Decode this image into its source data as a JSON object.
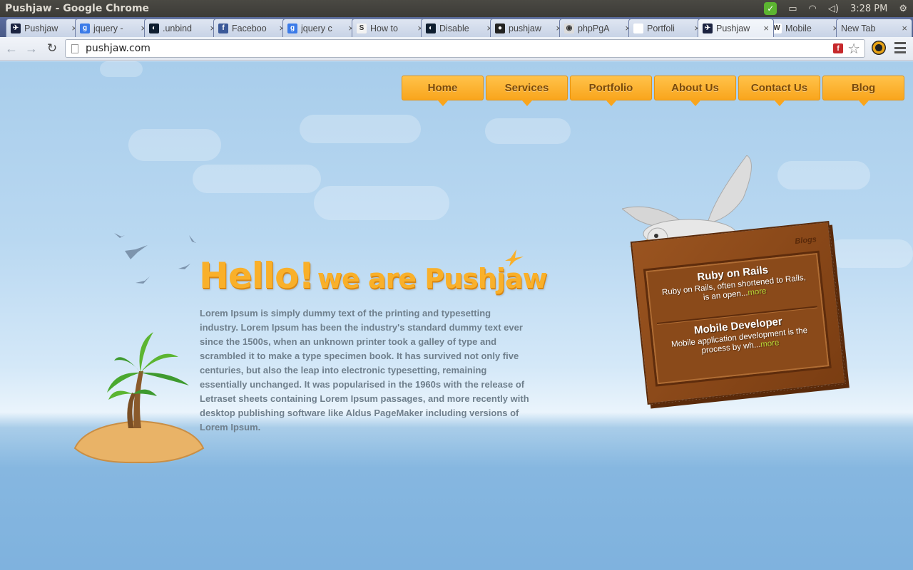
{
  "os": {
    "window_title": "Pushjaw - Google Chrome",
    "clock": "3:28 PM"
  },
  "tabs": [
    {
      "label": "Pushjaw",
      "icon": "pushjaw-icon",
      "color": "#1b2340",
      "glyph": "✈"
    },
    {
      "label": "jquery -",
      "icon": "google-icon",
      "color": "#3b7be8",
      "glyph": "g"
    },
    {
      "label": ".unbind",
      "icon": "jquery-icon",
      "color": "#0e1d2f",
      "glyph": "◐"
    },
    {
      "label": "Faceboo",
      "icon": "facebook-icon",
      "color": "#3b5998",
      "glyph": "f"
    },
    {
      "label": "jquery c",
      "icon": "google-icon",
      "color": "#3b7be8",
      "glyph": "g"
    },
    {
      "label": "How to",
      "icon": "stackoverflow-icon",
      "color": "#f2f2f2",
      "glyph": "S"
    },
    {
      "label": "Disable",
      "icon": "jquery-icon",
      "color": "#0e1d2f",
      "glyph": "◐"
    },
    {
      "label": "pushjaw",
      "icon": "github-icon",
      "color": "#222222",
      "glyph": "●"
    },
    {
      "label": "phpPgA",
      "icon": "postgres-icon",
      "color": "#dcdcdc",
      "glyph": "◉"
    },
    {
      "label": "Portfoli",
      "icon": "page-icon",
      "color": "#ffffff",
      "glyph": ""
    },
    {
      "label": "Pushjaw",
      "icon": "pushjaw-icon",
      "color": "#1b2340",
      "glyph": "✈"
    },
    {
      "label": "Mobile",
      "icon": "wikipedia-icon",
      "color": "#ffffff",
      "glyph": "W"
    },
    {
      "label": "New Tab",
      "icon": "",
      "color": "",
      "glyph": ""
    }
  ],
  "toolbar": {
    "url": "pushjaw.com"
  },
  "site": {
    "nav": [
      "Home",
      "Services",
      "Portfolio",
      "About Us",
      "Contact Us",
      "Blog"
    ],
    "hero_title_a": "Hello!",
    "hero_title_b": "we are Pushjaw",
    "hero_text": "Lorem Ipsum is simply dummy text of the printing and typesetting industry. Lorem Ipsum has been the industry's standard dummy text ever since the 1500s, when an unknown printer took a galley of type and scrambled it to make a type specimen book. It has survived not only five centuries, but also the leap into electronic typesetting, remaining essentially unchanged. It was popularised in the 1960s with the release of Letraset sheets containing Lorem Ipsum passages, and more recently with desktop publishing software like Aldus PageMaker including versions of Lorem Ipsum.",
    "board": {
      "tag": "Blogs",
      "posts": [
        {
          "title": "Ruby on Rails",
          "text": "Ruby on Rails, often shortened to Rails, is an open...",
          "more": "more"
        },
        {
          "title": "Mobile Developer",
          "text": "Mobile application development is the process by wh...",
          "more": "more"
        }
      ]
    },
    "colors": {
      "accent": "#f9a51c",
      "sky": "#a8cdeb",
      "board": "#8a4a1a"
    }
  }
}
